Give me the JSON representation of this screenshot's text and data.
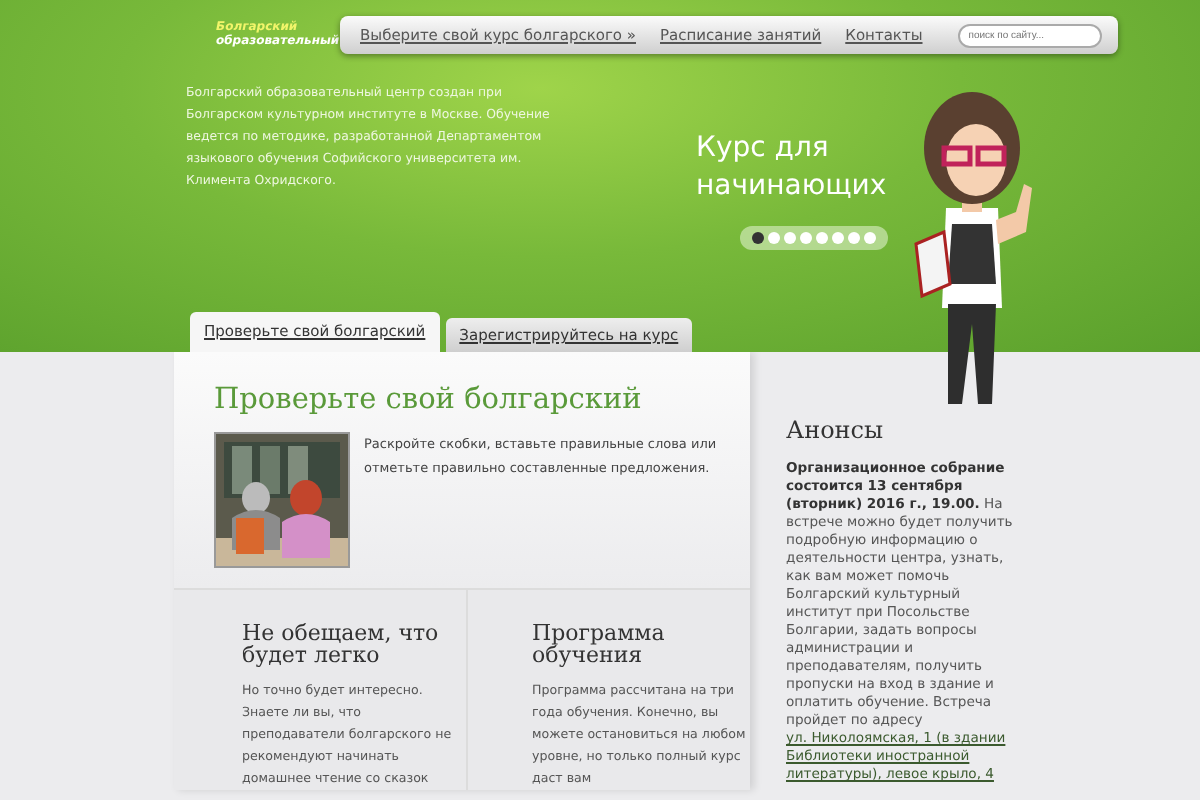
{
  "logo": {
    "line_1": "Болгарский",
    "line_2": "образовательный"
  },
  "nav": {
    "items": [
      {
        "label": "Выберите свой курс болгарского »"
      },
      {
        "label": "Расписание занятий"
      },
      {
        "label": "Контакты"
      }
    ],
    "search": {
      "placeholder": "поиск по сайту..."
    }
  },
  "intro": "Болгарский образовательный центр создан при Болгарском культурном институте в Москве. Обучение ведется по методике, разработанной Департаментом языкового обучения Софийского университета им. Климента Охридского.",
  "slide": {
    "headline": "Курс для начинающих",
    "dots": [
      {
        "selected": true
      },
      {
        "selected": false
      },
      {
        "selected": false
      },
      {
        "selected": false
      },
      {
        "selected": false
      },
      {
        "selected": false
      },
      {
        "selected": false
      },
      {
        "selected": false
      }
    ]
  },
  "tabs": [
    {
      "label": "Проверьте свой болгарский",
      "selected": true
    },
    {
      "label": "Зарегистрируйтесь на курс",
      "selected": false
    }
  ],
  "test": {
    "heading": "Проверьте свой болгарский",
    "text": "Раскройте скобки, вставьте правильные слова или отметьте правильно составленные предложения."
  },
  "features": [
    {
      "heading": "Не обещаем, что будет легко",
      "text": "Но точно будет интересно. Знаете ли вы, что преподаватели болгарского не рекомендуют начинать домашнее чтение со сказок"
    },
    {
      "heading": "Программа обучения",
      "text": "Программа рассчитана на три года обучения. Конечно, вы можете остановиться на любом уровне, но только полный курс даст вам"
    }
  ],
  "announcements": {
    "title": "Анонсы",
    "text": "**Организационное собрание состоится 13 сентября (вторник) 2016 г., 19.00.** На встрече можно будет получить подробную информацию о деятельности центра, узнать, как вам может помочь Болгарский культурный институт при Посольстве Болгарии, задать вопросы администрации и преподавателям, получить пропуски на вход в здание и оплатить обучение. Встреча пройдет по адресу",
    "link": "ул. Николоямская, 1 (в здании Библиотеки иностранной литературы), левое крыло, 4"
  }
}
